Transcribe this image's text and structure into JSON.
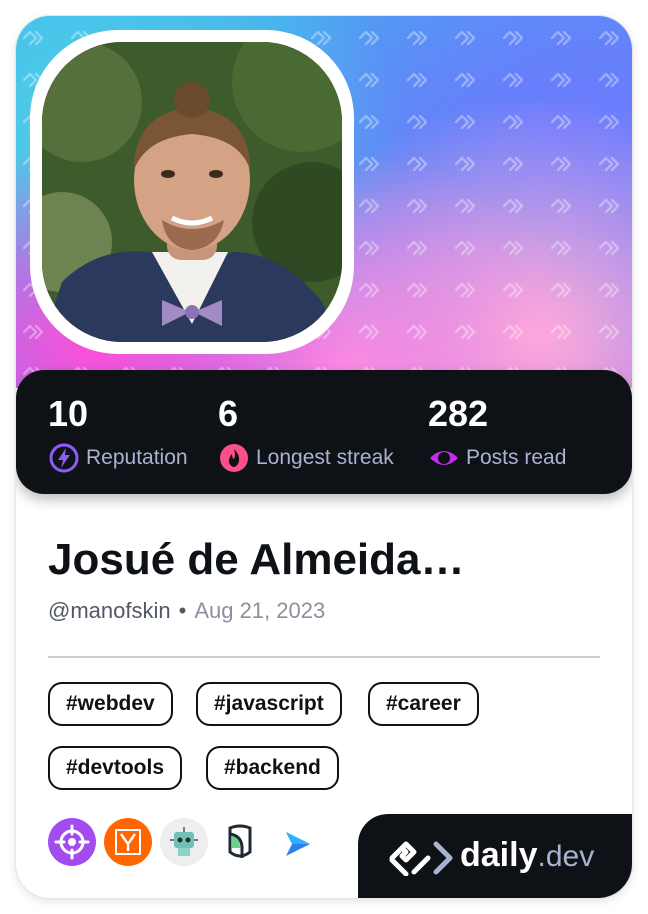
{
  "stats": [
    {
      "value": "10",
      "label": "Reputation",
      "icon": "reputation-bolt-icon",
      "color": "#8b5cf6"
    },
    {
      "value": "6",
      "label": "Longest streak",
      "icon": "streak-flame-icon",
      "color": "#ff4f8b"
    },
    {
      "value": "282",
      "label": "Posts read",
      "icon": "posts-read-eye-icon",
      "color": "#c12ee6"
    }
  ],
  "profile": {
    "name": "Josué de Almeida…",
    "username": "@manofskin",
    "separator": "•",
    "joined": "Aug 21, 2023"
  },
  "tags": [
    "#webdev",
    "#javascript",
    "#career",
    "#devtools",
    "#backend"
  ],
  "sources": [
    "crosshair-icon",
    "y-combinator-icon",
    "robot-icon",
    "shield-logo-icon",
    "arrow-logo-icon"
  ],
  "brand": {
    "name": "daily",
    "suffix": ".dev"
  },
  "colors": {
    "dark": "#0e1217",
    "label": "#a8b3cf",
    "accent_orange": "#ff6600",
    "accent_purple": "#a24cf0"
  }
}
